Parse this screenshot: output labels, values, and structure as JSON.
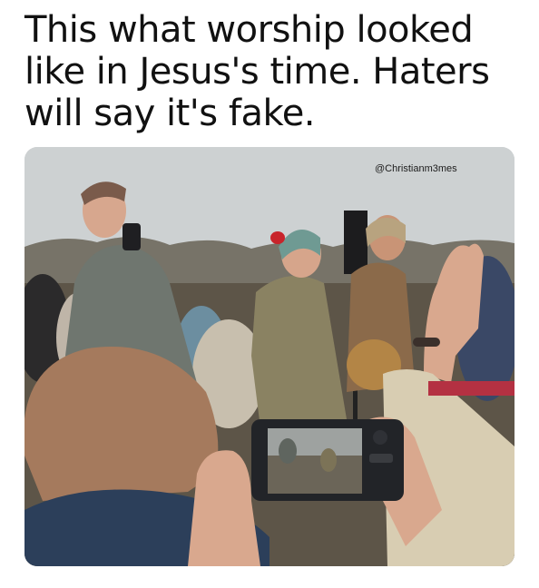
{
  "caption": {
    "lines": [
      "This what worship looked",
      "like in Jesus's time. Haters",
      "will say it's fake."
    ]
  },
  "photo": {
    "watermark": "@Christianm3mes",
    "scene_colors": {
      "sky": "#cdd1d2",
      "treeline": "#6e6a5e",
      "head_scarf_front": "#a57a5d",
      "jacket_front": "#2c3f5a",
      "singer_jacket": "#6f766f",
      "woman_headscarf": "#6f9a93",
      "woman_robe": "#8a8262",
      "guitarist_robe": "#8b6a4a",
      "phone": "#222428",
      "skin": "#d9a88e"
    }
  }
}
